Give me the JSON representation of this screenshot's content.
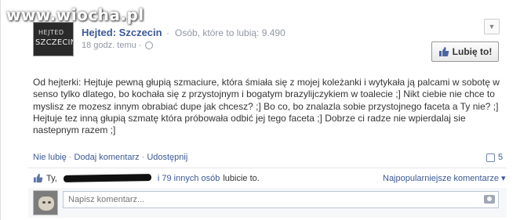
{
  "watermark": "www.wiocha.pl",
  "post": {
    "avatar_lines": [
      "HEJTED",
      "SZCZECIN"
    ],
    "page_name": "Hejted: Szczecin",
    "separator": "·",
    "likes_text": "Osób, które to lubią: 9.490",
    "time": "18 godz. temu ·",
    "like_page_button": "Lubię to!",
    "body": "Od hejterki: Hejtuje pewną głupią szmaciure, która śmiała się z mojej koleżanki i wytykała ją palcami w sobotę w senso tylko dlatego, bo kochała się z przystojnym i bogatym brazylijczykiem w toalecie ;] Nikt ciebie nie chce to myslisz ze mozesz innym obrabiać dupe jak chcesz? ;] Bo co, bo znalazla sobie przystojnego faceta a Ty nie? ;] Hejtuje tez inną głupią szmatę która próbowała odbić jej tego faceta ;] Dobrze ci radze nie wpierdalaj sie nastepnym razem ;]"
  },
  "actions": {
    "unlike": "Nie lubię",
    "comment": "Dodaj komentarz",
    "share": "Udostępnij",
    "comment_count": "5"
  },
  "likes_row": {
    "prefix": "Ty,",
    "suffix_link": "i 79 innych osób",
    "suffix_text": "lubicie to."
  },
  "sort_menu": "Najpopularniejsze komentarze ▾",
  "comment_box": {
    "placeholder": "Napisz komentarz..."
  },
  "colors": {
    "link": "#3b5998",
    "muted": "#9197a3"
  }
}
